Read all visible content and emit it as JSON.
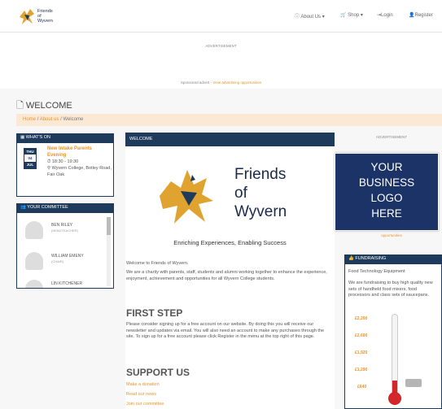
{
  "brand": {
    "line1": "Friends",
    "line2": "of",
    "line3": "Wyvern"
  },
  "nav": {
    "about": "About Us",
    "shop": "Shop",
    "login": "Login",
    "register": "Register"
  },
  "ad": {
    "label": "ADVERTISEMENT",
    "sponsored": "Sponsored advert -",
    "sponsored_link": "View advertising opportunities"
  },
  "page": {
    "title": "WELCOME"
  },
  "breadcrumb": {
    "home": "Home",
    "about": "About us",
    "current": "Welcome"
  },
  "whatson": {
    "title": "WHAT'S ON",
    "day": "THU",
    "date": "04",
    "month": "JUL",
    "event": "New Intake Parents Evening",
    "time": "18:30 - 19:30",
    "location": "Wyvern College, Botley Road, Fair Oak"
  },
  "committee": {
    "title": "YOUR COMMITTEE",
    "members": [
      {
        "name": "BEN RILEY",
        "role": "(HEADTEACHER)"
      },
      {
        "name": "WILLIAM EMENY",
        "role": "(CHAIR)"
      },
      {
        "name": "LIN KITCHENER",
        "role": "(VICE CHAIR)"
      }
    ]
  },
  "main": {
    "header": "WELCOME",
    "logo_line1": "Friends",
    "logo_line2": "of",
    "logo_line3": "Wyvern",
    "tagline": "Enriching Experiences, Enabling Success",
    "intro": "Welcome to Friends of Wyvern.",
    "para": "We are a charity with parents, staff, students and alumni working together to enhance the experience, enjoyment, achievement and opportunities for all Wyvern College students.",
    "first_step": "FIRST STEP",
    "first_para": "Please consider signing up for a free account on our website. By doing this you will receive our newsletter and updates via email. You will also need an account to make any purchases through the site. To sign up for a free account please click Register in the menu at the top right of this page.",
    "support": "SUPPORT US",
    "links": [
      "Make a donation",
      "Read our news",
      "Join our committee"
    ]
  },
  "sidead": {
    "label": "ADVERTISEMENT",
    "box": [
      "YOUR",
      "BUSINESS",
      "LOGO",
      "HERE"
    ],
    "link": "opportunities"
  },
  "fund": {
    "title": "FUNDRAISING",
    "item": "Food Technology Equipment",
    "text": "We are fundraising to buy high quality new sets of handheld food mixers, food processors and class sets of saucepans.",
    "scale": [
      "£2,200",
      "£2,600",
      "£1,920",
      "£1,290",
      "£640"
    ],
    "progress": 0.18
  }
}
